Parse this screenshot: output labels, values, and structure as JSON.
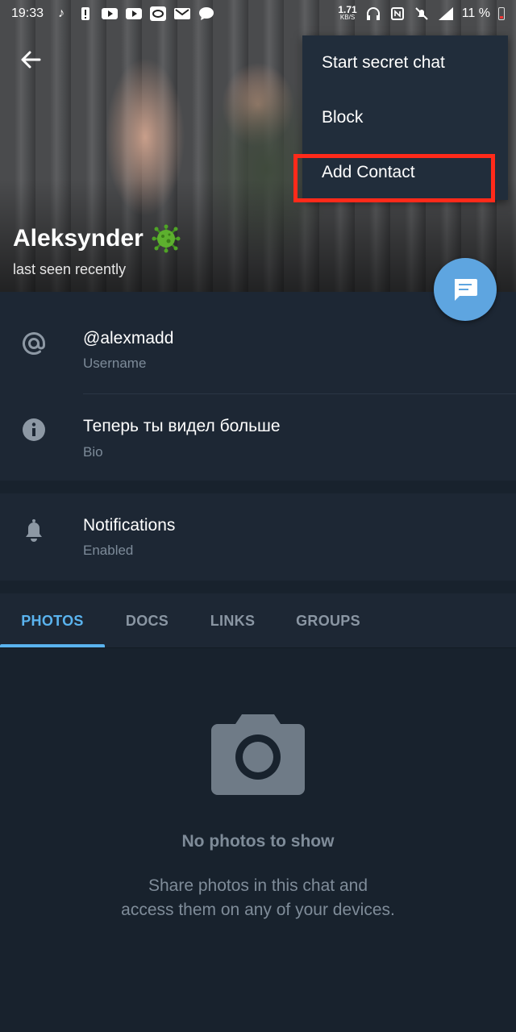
{
  "status_bar": {
    "time": "19:33",
    "net_speed": "1.71",
    "net_unit": "KB/S",
    "battery": "11 %",
    "icons": [
      "tiktok-icon",
      "alert-icon",
      "youtube-icon",
      "youtube-icon",
      "oval-app-icon",
      "gmail-icon",
      "message-icon",
      "headphones-icon",
      "nfc-icon",
      "mute-icon",
      "signal-icon",
      "battery-icon"
    ]
  },
  "profile": {
    "name": "Aleksynder",
    "last_seen": "last seen recently"
  },
  "menu": {
    "items": [
      "Start secret chat",
      "Block",
      "Add Contact"
    ],
    "highlight_color": "#ff2a1a"
  },
  "info": {
    "username_value": "@alexmadd",
    "username_label": "Username",
    "bio_value": "Теперь ты видел больше",
    "bio_label": "Bio",
    "notifications_value": "Notifications",
    "notifications_label": "Enabled"
  },
  "tabs": {
    "items": [
      "PHOTOS",
      "DOCS",
      "LINKS",
      "GROUPS"
    ],
    "active": "PHOTOS"
  },
  "empty_state": {
    "title": "No photos to show",
    "line1": "Share photos in this chat and",
    "line2": "access them on any of your devices."
  },
  "colors": {
    "background": "#18222d",
    "section": "#1d2734",
    "accent": "#5ab3ee",
    "fab": "#5ea5e0",
    "menu": "#212d3b"
  }
}
